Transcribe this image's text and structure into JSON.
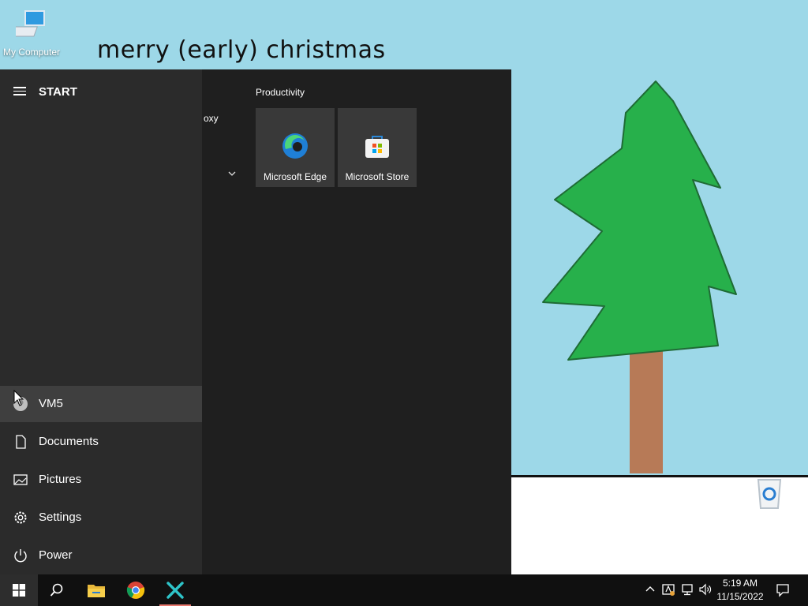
{
  "wallpaper": {
    "greeting": "merry (early) christmas"
  },
  "desktop_icons": [
    {
      "label": "My Computer",
      "icon": "computer-icon"
    },
    {
      "label": "",
      "icon": "recycle-bin-icon"
    }
  ],
  "start_menu": {
    "title": "START",
    "app_list_fragment": "oxy",
    "nav": [
      {
        "label": "VM5",
        "icon": "user-avatar-icon"
      },
      {
        "label": "Documents",
        "icon": "document-icon"
      },
      {
        "label": "Pictures",
        "icon": "pictures-icon"
      },
      {
        "label": "Settings",
        "icon": "gear-icon"
      },
      {
        "label": "Power",
        "icon": "power-icon"
      }
    ],
    "group": {
      "title": "Productivity",
      "tiles": [
        {
          "label": "Microsoft Edge",
          "icon": "edge-icon"
        },
        {
          "label": "Microsoft Store",
          "icon": "store-icon"
        }
      ]
    }
  },
  "taskbar": {
    "pinned": [
      {
        "icon": "windows-start-icon"
      },
      {
        "icon": "search-icon"
      },
      {
        "icon": "file-explorer-icon"
      },
      {
        "icon": "chrome-icon"
      },
      {
        "icon": "app-x-icon"
      }
    ],
    "tray_icons": [
      "chevron-up-icon",
      "tray-app-icon",
      "network-icon",
      "volume-icon"
    ],
    "time": "5:19 AM",
    "date": "11/15/2022",
    "notification_icon": "notification-icon"
  },
  "colors": {
    "sky": "#9dd8e8",
    "tree": "#27b04b",
    "trunk": "#b77a57",
    "accent": "#e8786e"
  }
}
